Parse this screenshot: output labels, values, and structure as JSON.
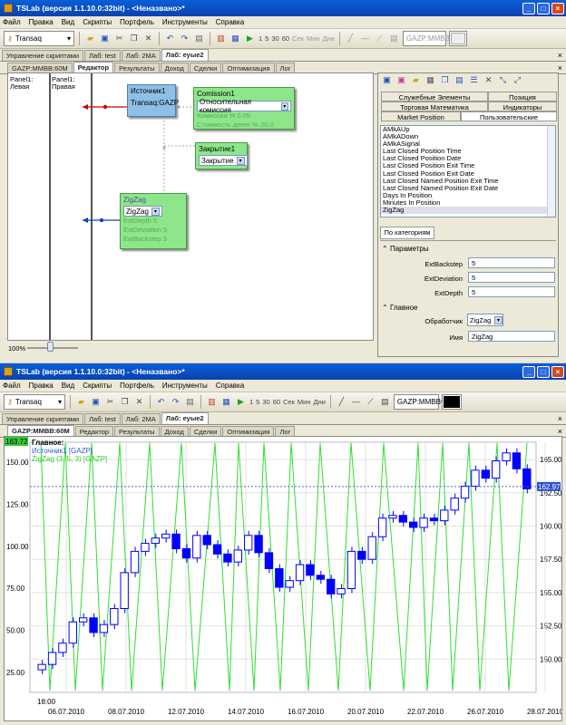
{
  "window": {
    "title": "TSLab (версия 1.1.10.0:32bit) - <Неназвано>*",
    "controls": [
      "_",
      "□",
      "×"
    ]
  },
  "menu": [
    "Файл",
    "Правка",
    "Вид",
    "Скрипты",
    "Портфель",
    "Инструменты",
    "Справка"
  ],
  "toolbar": {
    "provider": "Transaq",
    "intervals": [
      "1",
      "5",
      "30",
      "60"
    ],
    "intervals_bottom": [
      "1",
      "5",
      "30",
      "60",
      "Сек",
      "Мин",
      "Дни"
    ],
    "interval_words_top": [
      "Сек",
      "Мин",
      "Дни"
    ],
    "instrument": "GAZP:MMBB",
    "instrument_bottom": "GAZP:MMBB"
  },
  "outer_tabs": [
    "Управление скриптами",
    "Лаб: test",
    "Лаб: 2MA",
    "Лаб: еуые2"
  ],
  "inner_tabs": [
    "GAZP:MMBB:60M",
    "Редактор",
    "Результаты",
    "Доход",
    "Сделки",
    "Оптимизация",
    "Лог"
  ],
  "editor": {
    "panes": [
      {
        "name": "Panel1:",
        "side": "Левая"
      },
      {
        "name": "Panel1:",
        "side": "Правая"
      }
    ],
    "source": {
      "title": "Источник1",
      "value": "Transaq:GAZP"
    },
    "commission": {
      "title": "Comission1",
      "value": "Относительная комиссия",
      "params": [
        "Комиссия %          0.05",
        "Стоимость денег %   20.0"
      ]
    },
    "close": {
      "title": "Закрытие1",
      "value": "Закрытие"
    },
    "zigzag": {
      "title": "ZigZag",
      "value": "ZigZag",
      "params": [
        "ExtDepth          5",
        "ExtDeviation      5",
        "ExtBackstep       3"
      ]
    },
    "zoom": "100%"
  },
  "right_panel": {
    "tab_row1": [
      "Служебные Элементы",
      "Позиция"
    ],
    "tab_row2": [
      "Торговая Математика",
      "Индикаторы"
    ],
    "tab_row3": [
      "Market Position",
      "Пользовательские"
    ],
    "list_items": [
      "AMkAUp",
      "AMkADown",
      "AMkASignal",
      "Last Closed Position Time",
      "Last Closed Position Date",
      "Last Closed Position Exit Time",
      "Last Closed Position Exit Date",
      "Last Closed Named Position Exit Time",
      "Last Closed Named Position Exit Date",
      "Days In Position",
      "Minutes In Position",
      "ZigZag"
    ],
    "category_tab": "По категориям",
    "params_header": "Параметры",
    "params": [
      {
        "label": "ExtBackstep",
        "value": "5"
      },
      {
        "label": "ExtDeviation",
        "value": "5"
      },
      {
        "label": "ExtDepth",
        "value": "5"
      }
    ],
    "main_header": "Главное",
    "handler_label": "Обработчик",
    "handler_value": "ZigZag",
    "name_label": "Имя",
    "name_value": "ZigZag"
  },
  "chart_data": {
    "type": "line",
    "legend": [
      "Главное:",
      "Источник1 [GAZP]",
      "ZigZag (3, 5, 3) [GAZP]"
    ],
    "colors": {
      "price": "#0000ff",
      "zigzag": "#33dd33",
      "label_green": "#33cc33",
      "label_blue": "#3060d0"
    },
    "left_axis": [
      150.0,
      125.0,
      100.0,
      75.0,
      50.0,
      25.0
    ],
    "left_current": "163.72",
    "right_axis": [
      165.0,
      162.5,
      160.0,
      157.5,
      155.0,
      152.5,
      150.0
    ],
    "right_current": "162.97",
    "time_label": "18:00",
    "dates": [
      "06.07.2010",
      "08.07.2010",
      "12.07.2010",
      "14.07.2010",
      "16.07.2010",
      "20.07.2010",
      "22.07.2010",
      "26.07.2010",
      "28.07.2010"
    ],
    "price_approx": [
      149.6,
      150.5,
      151.2,
      152.8,
      153.1,
      152.0,
      152.6,
      153.8,
      156.5,
      158.1,
      158.7,
      159.1,
      159.4,
      158.3,
      157.6,
      159.3,
      158.6,
      157.9,
      157.3,
      158.2,
      159.3,
      158.0,
      156.8,
      155.4,
      155.9,
      157.1,
      156.3,
      156.0,
      154.9,
      155.3,
      158.1,
      157.5,
      159.2,
      160.6,
      160.8,
      160.3,
      159.9,
      160.6,
      160.4,
      161.2,
      162.1,
      163.0,
      164.2,
      163.6,
      164.9,
      165.5,
      164.3,
      162.8
    ],
    "zigzag_values": [
      0,
      163.72
    ]
  }
}
